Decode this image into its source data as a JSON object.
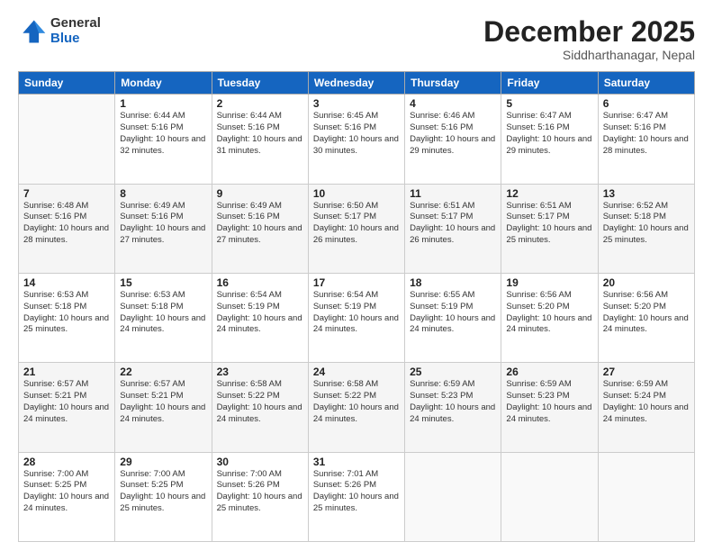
{
  "logo": {
    "general": "General",
    "blue": "Blue"
  },
  "title": "December 2025",
  "subtitle": "Siddharthanagar, Nepal",
  "header_days": [
    "Sunday",
    "Monday",
    "Tuesday",
    "Wednesday",
    "Thursday",
    "Friday",
    "Saturday"
  ],
  "weeks": [
    [
      {
        "day": "",
        "sunrise": "",
        "sunset": "",
        "daylight": ""
      },
      {
        "day": "1",
        "sunrise": "Sunrise: 6:44 AM",
        "sunset": "Sunset: 5:16 PM",
        "daylight": "Daylight: 10 hours and 32 minutes."
      },
      {
        "day": "2",
        "sunrise": "Sunrise: 6:44 AM",
        "sunset": "Sunset: 5:16 PM",
        "daylight": "Daylight: 10 hours and 31 minutes."
      },
      {
        "day": "3",
        "sunrise": "Sunrise: 6:45 AM",
        "sunset": "Sunset: 5:16 PM",
        "daylight": "Daylight: 10 hours and 30 minutes."
      },
      {
        "day": "4",
        "sunrise": "Sunrise: 6:46 AM",
        "sunset": "Sunset: 5:16 PM",
        "daylight": "Daylight: 10 hours and 29 minutes."
      },
      {
        "day": "5",
        "sunrise": "Sunrise: 6:47 AM",
        "sunset": "Sunset: 5:16 PM",
        "daylight": "Daylight: 10 hours and 29 minutes."
      },
      {
        "day": "6",
        "sunrise": "Sunrise: 6:47 AM",
        "sunset": "Sunset: 5:16 PM",
        "daylight": "Daylight: 10 hours and 28 minutes."
      }
    ],
    [
      {
        "day": "7",
        "sunrise": "Sunrise: 6:48 AM",
        "sunset": "Sunset: 5:16 PM",
        "daylight": "Daylight: 10 hours and 28 minutes."
      },
      {
        "day": "8",
        "sunrise": "Sunrise: 6:49 AM",
        "sunset": "Sunset: 5:16 PM",
        "daylight": "Daylight: 10 hours and 27 minutes."
      },
      {
        "day": "9",
        "sunrise": "Sunrise: 6:49 AM",
        "sunset": "Sunset: 5:16 PM",
        "daylight": "Daylight: 10 hours and 27 minutes."
      },
      {
        "day": "10",
        "sunrise": "Sunrise: 6:50 AM",
        "sunset": "Sunset: 5:17 PM",
        "daylight": "Daylight: 10 hours and 26 minutes."
      },
      {
        "day": "11",
        "sunrise": "Sunrise: 6:51 AM",
        "sunset": "Sunset: 5:17 PM",
        "daylight": "Daylight: 10 hours and 26 minutes."
      },
      {
        "day": "12",
        "sunrise": "Sunrise: 6:51 AM",
        "sunset": "Sunset: 5:17 PM",
        "daylight": "Daylight: 10 hours and 25 minutes."
      },
      {
        "day": "13",
        "sunrise": "Sunrise: 6:52 AM",
        "sunset": "Sunset: 5:18 PM",
        "daylight": "Daylight: 10 hours and 25 minutes."
      }
    ],
    [
      {
        "day": "14",
        "sunrise": "Sunrise: 6:53 AM",
        "sunset": "Sunset: 5:18 PM",
        "daylight": "Daylight: 10 hours and 25 minutes."
      },
      {
        "day": "15",
        "sunrise": "Sunrise: 6:53 AM",
        "sunset": "Sunset: 5:18 PM",
        "daylight": "Daylight: 10 hours and 24 minutes."
      },
      {
        "day": "16",
        "sunrise": "Sunrise: 6:54 AM",
        "sunset": "Sunset: 5:19 PM",
        "daylight": "Daylight: 10 hours and 24 minutes."
      },
      {
        "day": "17",
        "sunrise": "Sunrise: 6:54 AM",
        "sunset": "Sunset: 5:19 PM",
        "daylight": "Daylight: 10 hours and 24 minutes."
      },
      {
        "day": "18",
        "sunrise": "Sunrise: 6:55 AM",
        "sunset": "Sunset: 5:19 PM",
        "daylight": "Daylight: 10 hours and 24 minutes."
      },
      {
        "day": "19",
        "sunrise": "Sunrise: 6:56 AM",
        "sunset": "Sunset: 5:20 PM",
        "daylight": "Daylight: 10 hours and 24 minutes."
      },
      {
        "day": "20",
        "sunrise": "Sunrise: 6:56 AM",
        "sunset": "Sunset: 5:20 PM",
        "daylight": "Daylight: 10 hours and 24 minutes."
      }
    ],
    [
      {
        "day": "21",
        "sunrise": "Sunrise: 6:57 AM",
        "sunset": "Sunset: 5:21 PM",
        "daylight": "Daylight: 10 hours and 24 minutes."
      },
      {
        "day": "22",
        "sunrise": "Sunrise: 6:57 AM",
        "sunset": "Sunset: 5:21 PM",
        "daylight": "Daylight: 10 hours and 24 minutes."
      },
      {
        "day": "23",
        "sunrise": "Sunrise: 6:58 AM",
        "sunset": "Sunset: 5:22 PM",
        "daylight": "Daylight: 10 hours and 24 minutes."
      },
      {
        "day": "24",
        "sunrise": "Sunrise: 6:58 AM",
        "sunset": "Sunset: 5:22 PM",
        "daylight": "Daylight: 10 hours and 24 minutes."
      },
      {
        "day": "25",
        "sunrise": "Sunrise: 6:59 AM",
        "sunset": "Sunset: 5:23 PM",
        "daylight": "Daylight: 10 hours and 24 minutes."
      },
      {
        "day": "26",
        "sunrise": "Sunrise: 6:59 AM",
        "sunset": "Sunset: 5:23 PM",
        "daylight": "Daylight: 10 hours and 24 minutes."
      },
      {
        "day": "27",
        "sunrise": "Sunrise: 6:59 AM",
        "sunset": "Sunset: 5:24 PM",
        "daylight": "Daylight: 10 hours and 24 minutes."
      }
    ],
    [
      {
        "day": "28",
        "sunrise": "Sunrise: 7:00 AM",
        "sunset": "Sunset: 5:25 PM",
        "daylight": "Daylight: 10 hours and 24 minutes."
      },
      {
        "day": "29",
        "sunrise": "Sunrise: 7:00 AM",
        "sunset": "Sunset: 5:25 PM",
        "daylight": "Daylight: 10 hours and 25 minutes."
      },
      {
        "day": "30",
        "sunrise": "Sunrise: 7:00 AM",
        "sunset": "Sunset: 5:26 PM",
        "daylight": "Daylight: 10 hours and 25 minutes."
      },
      {
        "day": "31",
        "sunrise": "Sunrise: 7:01 AM",
        "sunset": "Sunset: 5:26 PM",
        "daylight": "Daylight: 10 hours and 25 minutes."
      },
      {
        "day": "",
        "sunrise": "",
        "sunset": "",
        "daylight": ""
      },
      {
        "day": "",
        "sunrise": "",
        "sunset": "",
        "daylight": ""
      },
      {
        "day": "",
        "sunrise": "",
        "sunset": "",
        "daylight": ""
      }
    ]
  ]
}
